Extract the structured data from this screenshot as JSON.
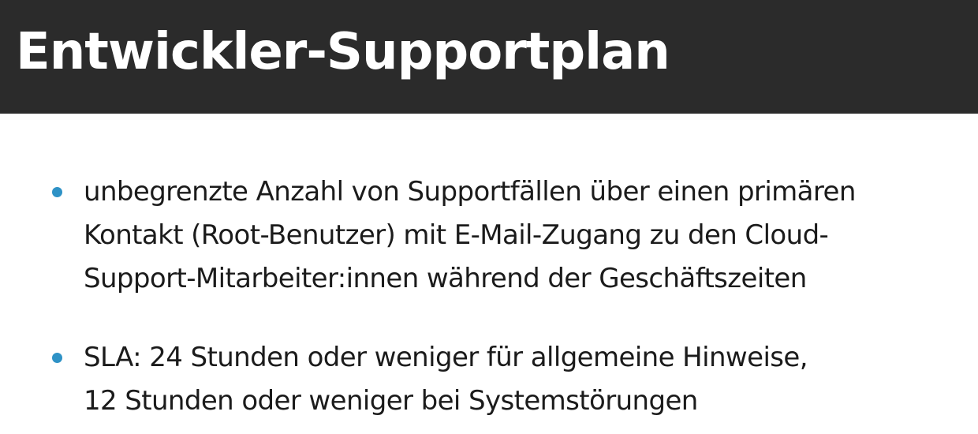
{
  "slide": {
    "title": "Entwickler-Supportplan",
    "bullets": [
      {
        "lines": [
          "unbegrenzte Anzahl von Supportfällen über einen primären",
          "Kontakt (Root-Benutzer) mit E-Mail-Zugang zu den Cloud-",
          "Support-Mitarbeiter:innen während der Geschäftszeiten"
        ]
      },
      {
        "lines": [
          "SLA: 24 Stunden oder weniger für allgemeine Hinweise,",
          "12 Stunden oder weniger bei Systemstörungen"
        ]
      }
    ]
  },
  "colors": {
    "title_bar": "#2b2b2b",
    "title_text": "#ffffff",
    "bullet_dot": "#2e92c6",
    "body_text": "#1b1b1b",
    "background": "#ffffff"
  }
}
